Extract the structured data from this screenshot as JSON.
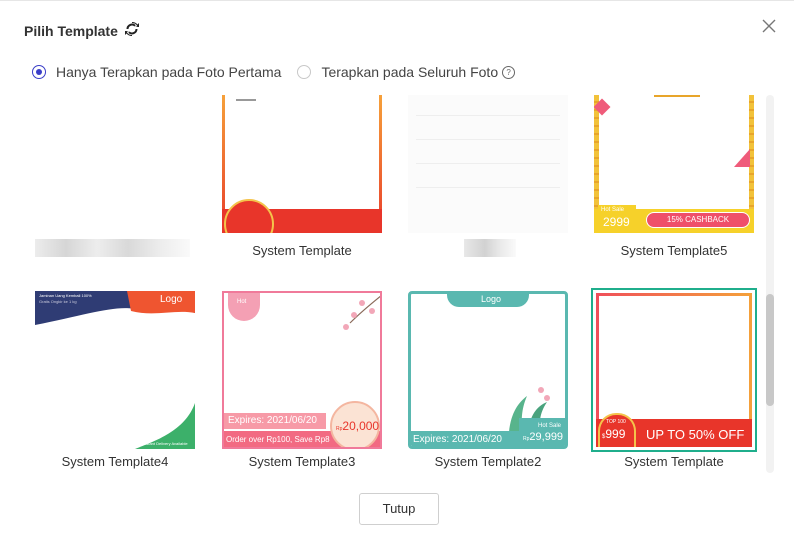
{
  "dialog": {
    "title": "Pilih Template",
    "close_label": "X",
    "radio_first": "Hanya Terapkan pada Foto Pertama",
    "radio_all": "Terapkan pada Seluruh Foto",
    "close_button": "Tutup"
  },
  "templates": [
    {
      "caption": "",
      "overlay": {}
    },
    {
      "caption": "System Template",
      "overlay": {}
    },
    {
      "caption": "",
      "overlay": {}
    },
    {
      "caption": "System Template5",
      "overlay": {
        "hot": "Hot Sale",
        "price": "2999",
        "cashback": "15% CASHBACK"
      }
    },
    {
      "caption": "System Template4",
      "overlay": {
        "logo": "Logo",
        "head": "Jaminan Uang Kembali 100%",
        "sub": "Gratis Ongkir ke 1 kg",
        "foot": "Instant Delivery Available"
      }
    },
    {
      "caption": "System Template3",
      "overlay": {
        "hot": "Hot",
        "expires": "Expires:  2021/06/20",
        "price": "20,000",
        "price_prefix": "Rp",
        "order": "Order over Rp100, Save Rp8"
      }
    },
    {
      "caption": "System Template2",
      "overlay": {
        "logo": "Logo",
        "expires": "Expires:   2021/06/20",
        "hot": "Hot Sale",
        "price": "29,999",
        "price_prefix": "Rp"
      }
    },
    {
      "caption": "System Template",
      "overlay": {
        "top": "TOP 100",
        "price": "999",
        "price_prefix": "$",
        "promo": "UP TO 50% OFF"
      }
    }
  ],
  "colors": {
    "accent": "#3a3ec8",
    "selected": "#1fae8c"
  }
}
